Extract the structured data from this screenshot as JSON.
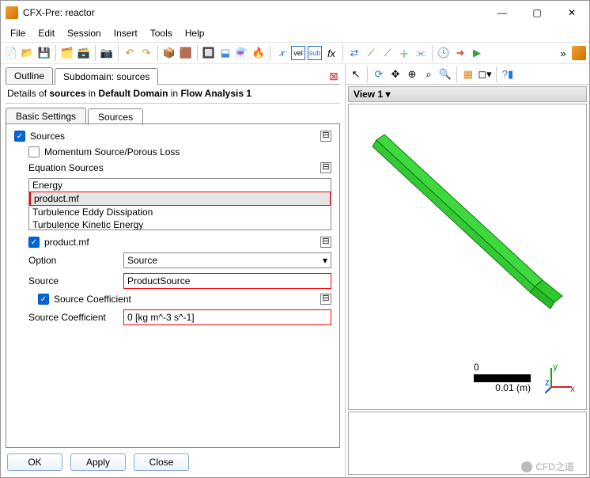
{
  "title": "CFX-Pre:  reactor",
  "menu": {
    "items": [
      "File",
      "Edit",
      "Session",
      "Insert",
      "Tools",
      "Help"
    ]
  },
  "tabs_top": {
    "outline": "Outline",
    "subdomain": "Subdomain: sources"
  },
  "details_line": {
    "pre": "Details of ",
    "b1": "sources",
    "mid": " in ",
    "b2": "Default Domain",
    "mid2": " in ",
    "b3": "Flow Analysis 1"
  },
  "tabs_detail": {
    "basic": "Basic Settings",
    "sources": "Sources"
  },
  "sources": {
    "label": "Sources",
    "momentum": "Momentum Source/Porous Loss",
    "equation_label": "Equation Sources",
    "items": [
      "Energy",
      "product.mf",
      "Turbulence Eddy Dissipation",
      "Turbulence Kinetic Energy"
    ],
    "product_mf_label": "product.mf",
    "option_label": "Option",
    "option_value": "Source",
    "source_label": "Source",
    "source_value": "ProductSource",
    "coeff_chk": "Source Coefficient",
    "coeff_label": "Source Coefficient",
    "coeff_value": "0 [kg m^-3 s^-1]"
  },
  "buttons": {
    "ok": "OK",
    "apply": "Apply",
    "close": "Close"
  },
  "view": {
    "tab": "View 1  ▾"
  },
  "scale": {
    "zero": "0",
    "val": "0.01",
    "unit": "(m)"
  },
  "watermark": "CFD之道"
}
